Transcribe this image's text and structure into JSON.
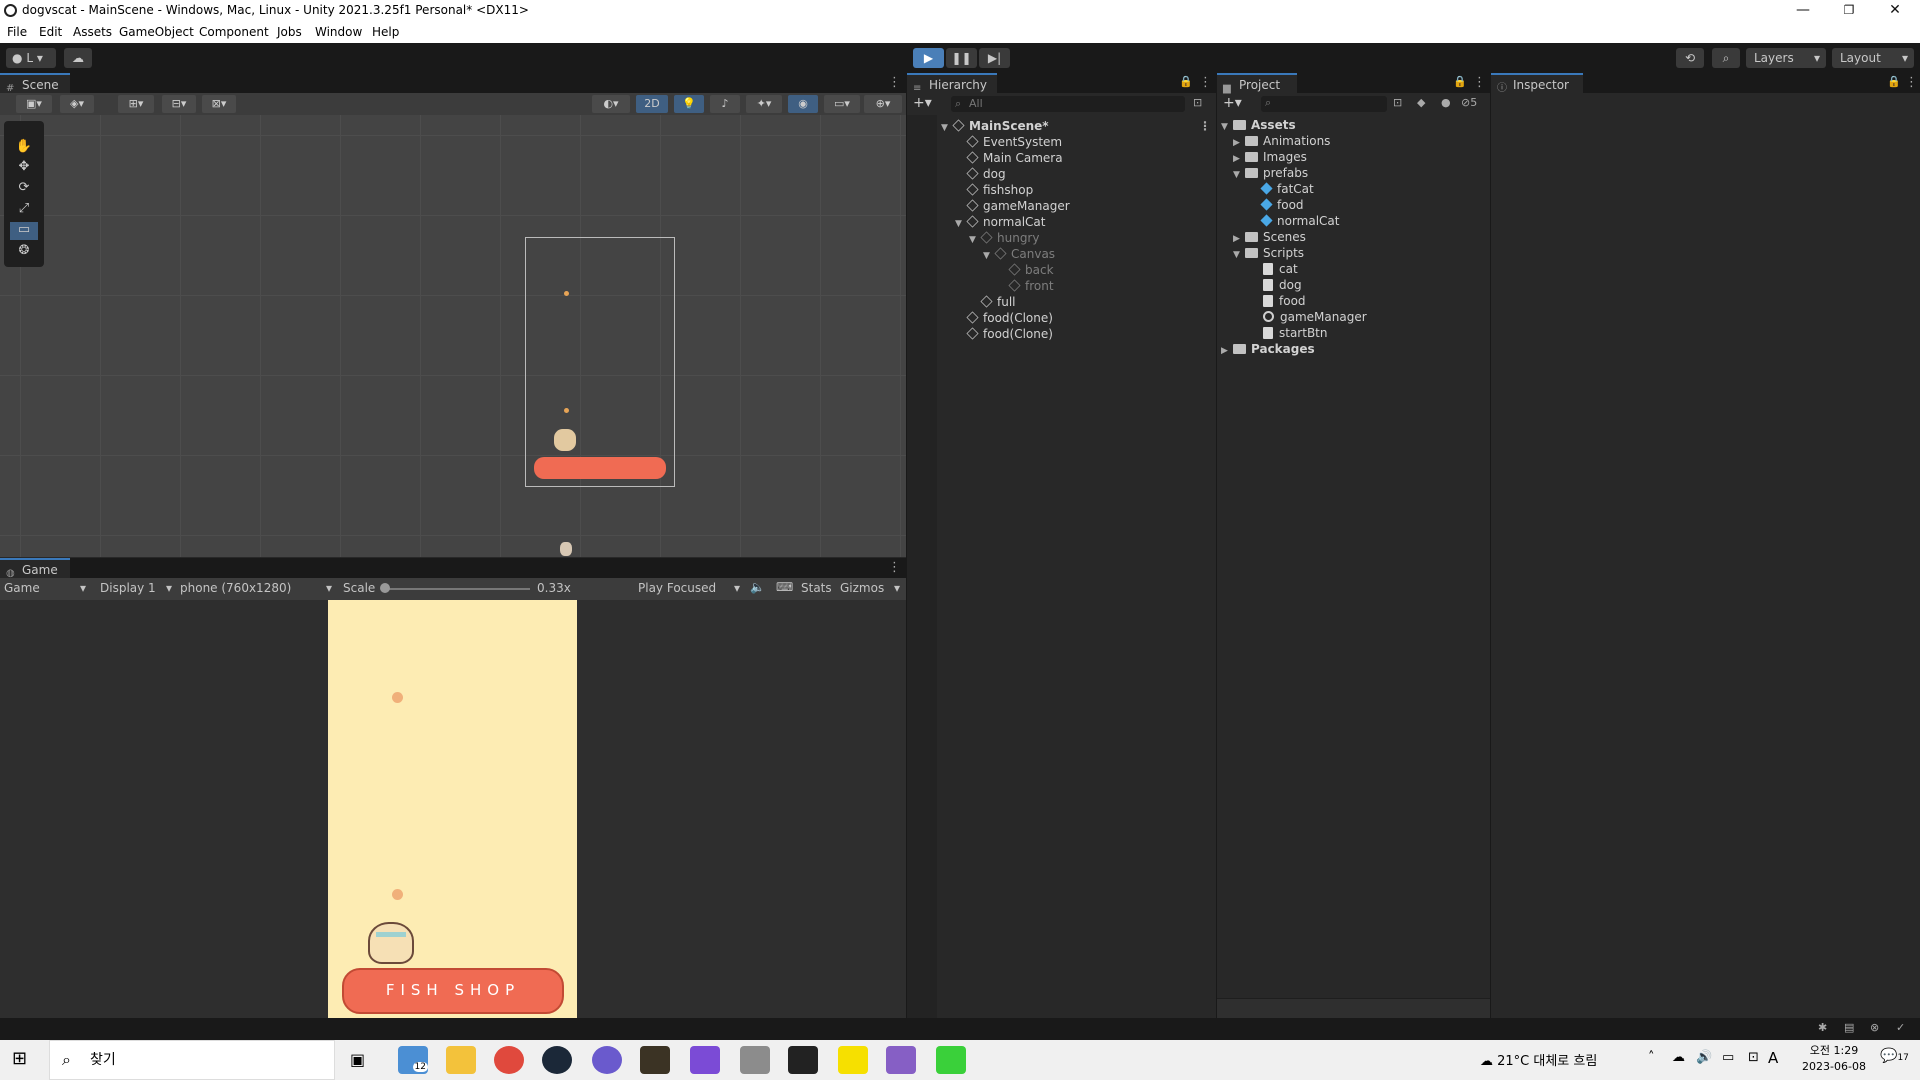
{
  "window": {
    "title": "dogvscat - MainScene - Windows, Mac, Linux - Unity 2021.3.25f1 Personal* <DX11>"
  },
  "menu": [
    "File",
    "Edit",
    "Assets",
    "GameObject",
    "Component",
    "Jobs",
    "Window",
    "Help"
  ],
  "toolbar": {
    "account": "L",
    "layers": "Layers",
    "layout": "Layout"
  },
  "scene": {
    "tab": "Scene",
    "mode2d": "2D"
  },
  "game": {
    "tab": "Game",
    "view": "Game",
    "display": "Display 1",
    "resolution": "phone (760x1280)",
    "scale_label": "Scale",
    "scale_value": "0.33x",
    "play_mode": "Play Focused",
    "stats": "Stats",
    "gizmos": "Gizmos",
    "sign": "FISH SHOP"
  },
  "hierarchy": {
    "tab": "Hierarchy",
    "search_placeholder": "All",
    "items": [
      {
        "label": "MainScene*"
      },
      {
        "label": "EventSystem"
      },
      {
        "label": "Main Camera"
      },
      {
        "label": "dog"
      },
      {
        "label": "fishshop"
      },
      {
        "label": "gameManager"
      },
      {
        "label": "normalCat"
      },
      {
        "label": "hungry"
      },
      {
        "label": "Canvas"
      },
      {
        "label": "back"
      },
      {
        "label": "front"
      },
      {
        "label": "full"
      },
      {
        "label": "food(Clone)"
      },
      {
        "label": "food(Clone)"
      }
    ]
  },
  "project": {
    "tab": "Project",
    "hidden_count": "5",
    "items": [
      {
        "label": "Assets"
      },
      {
        "label": "Animations"
      },
      {
        "label": "Images"
      },
      {
        "label": "prefabs"
      },
      {
        "label": "fatCat"
      },
      {
        "label": "food"
      },
      {
        "label": "normalCat"
      },
      {
        "label": "Scenes"
      },
      {
        "label": "Scripts"
      },
      {
        "label": "cat"
      },
      {
        "label": "dog"
      },
      {
        "label": "food"
      },
      {
        "label": "gameManager"
      },
      {
        "label": "startBtn"
      },
      {
        "label": "Packages"
      }
    ]
  },
  "inspector": {
    "tab": "Inspector"
  },
  "taskbar": {
    "search": "찾기",
    "mail_badge": "12",
    "weather": "21°C 대체로 흐림",
    "ime": "A",
    "time": "오전 1:29",
    "date": "2023-06-08",
    "notif_count": "17"
  },
  "colors": {
    "accent": "#3a79bb",
    "game_bg": "#fdecb3",
    "shop_sign": "#f06b53"
  }
}
